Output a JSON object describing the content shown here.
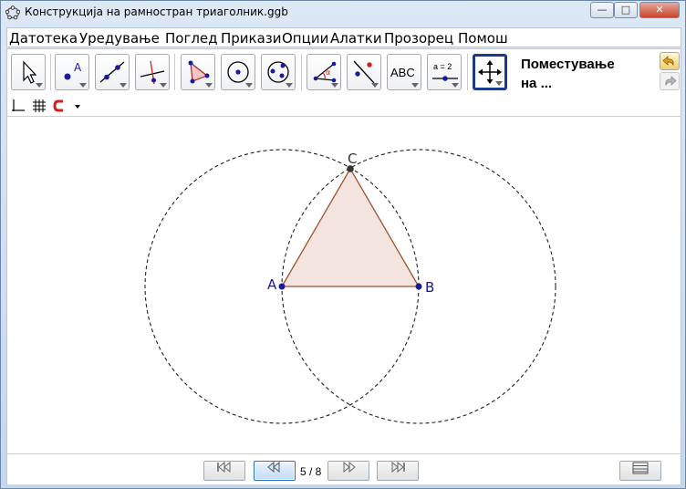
{
  "window": {
    "title": "Конструкција на рамностран триаголник.ggb",
    "controls": {
      "minimize": "—",
      "maximize": "□",
      "close": "✕"
    }
  },
  "menu": {
    "items": [
      {
        "label": "Датотека"
      },
      {
        "label": "Уредување"
      },
      {
        "label": "Поглед"
      },
      {
        "label": "Прикази"
      },
      {
        "label": "Опции"
      },
      {
        "label": "Алатки"
      },
      {
        "label": "Прозорец"
      },
      {
        "label": "Помош"
      }
    ]
  },
  "toolbar": {
    "active_tool_label_line1": "Поместување",
    "active_tool_label_line2": "на ...",
    "tools": [
      {
        "icon": "arrow-select-icon"
      },
      {
        "icon": "point-icon"
      },
      {
        "icon": "line-icon"
      },
      {
        "icon": "perpendicular-icon"
      },
      {
        "icon": "polygon-icon"
      },
      {
        "icon": "circle-center-icon"
      },
      {
        "icon": "circle-three-points-icon"
      },
      {
        "icon": "angle-icon"
      },
      {
        "icon": "reflect-icon"
      },
      {
        "icon": "text-icon",
        "text": "ABC"
      },
      {
        "icon": "slider-icon",
        "text": "a = 2"
      },
      {
        "icon": "move-graphics-icon"
      }
    ],
    "alpha_symbol": "α"
  },
  "graphics": {
    "points": [
      {
        "name": "A"
      },
      {
        "name": "B"
      },
      {
        "name": "C"
      }
    ],
    "colors": {
      "point": "#1a1a9c",
      "point_c": "#333333",
      "triangle_edge": "#a0522d",
      "triangle_fill": "#f3e4e0",
      "circle": "#222222"
    }
  },
  "navigation": {
    "counter": "5 / 8",
    "buttons": [
      "first-icon",
      "back-icon",
      "play-forward-icon",
      "last-icon"
    ]
  }
}
